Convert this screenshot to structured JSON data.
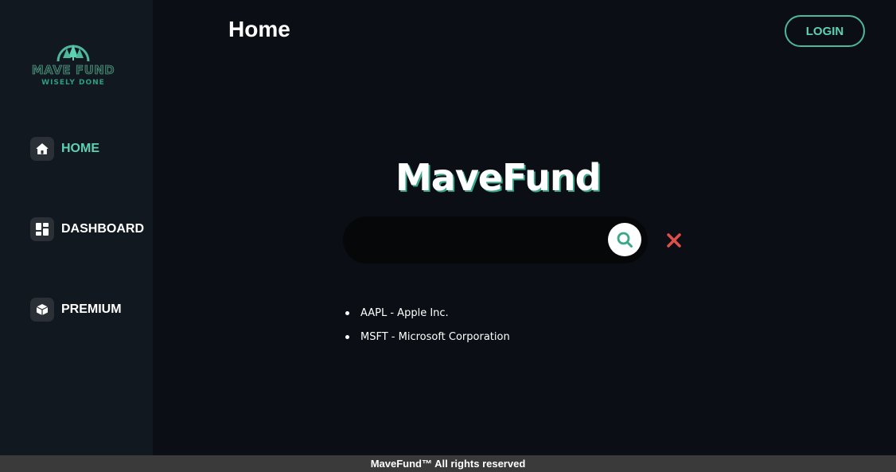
{
  "logo": {
    "name": "MAVE FUND",
    "tagline": "WISELY DONE",
    "icon": "tree-arc-logo"
  },
  "sidebar": {
    "items": [
      {
        "label": "HOME",
        "icon": "home-icon",
        "active": true
      },
      {
        "label": "DASHBOARD",
        "icon": "dashboard-grid-icon",
        "active": false
      },
      {
        "label": "PREMIUM",
        "icon": "cube-icon",
        "active": false
      }
    ]
  },
  "header": {
    "title": "Home",
    "login_label": "LOGIN"
  },
  "main": {
    "brand_title": "MaveFund",
    "search": {
      "value": "",
      "placeholder": ""
    },
    "results": [
      {
        "text": "AAPL - Apple Inc."
      },
      {
        "text": "MSFT - Microsoft Corporation"
      }
    ]
  },
  "footer": {
    "text": "MaveFund™ All rights reserved"
  },
  "colors": {
    "accent": "#5fd1b3",
    "accent_dark": "#3aa68a",
    "background": "#0b0f15",
    "sidebar": "#111820",
    "clear_icon": "#e0504a",
    "footer": "#3a3a3a"
  }
}
